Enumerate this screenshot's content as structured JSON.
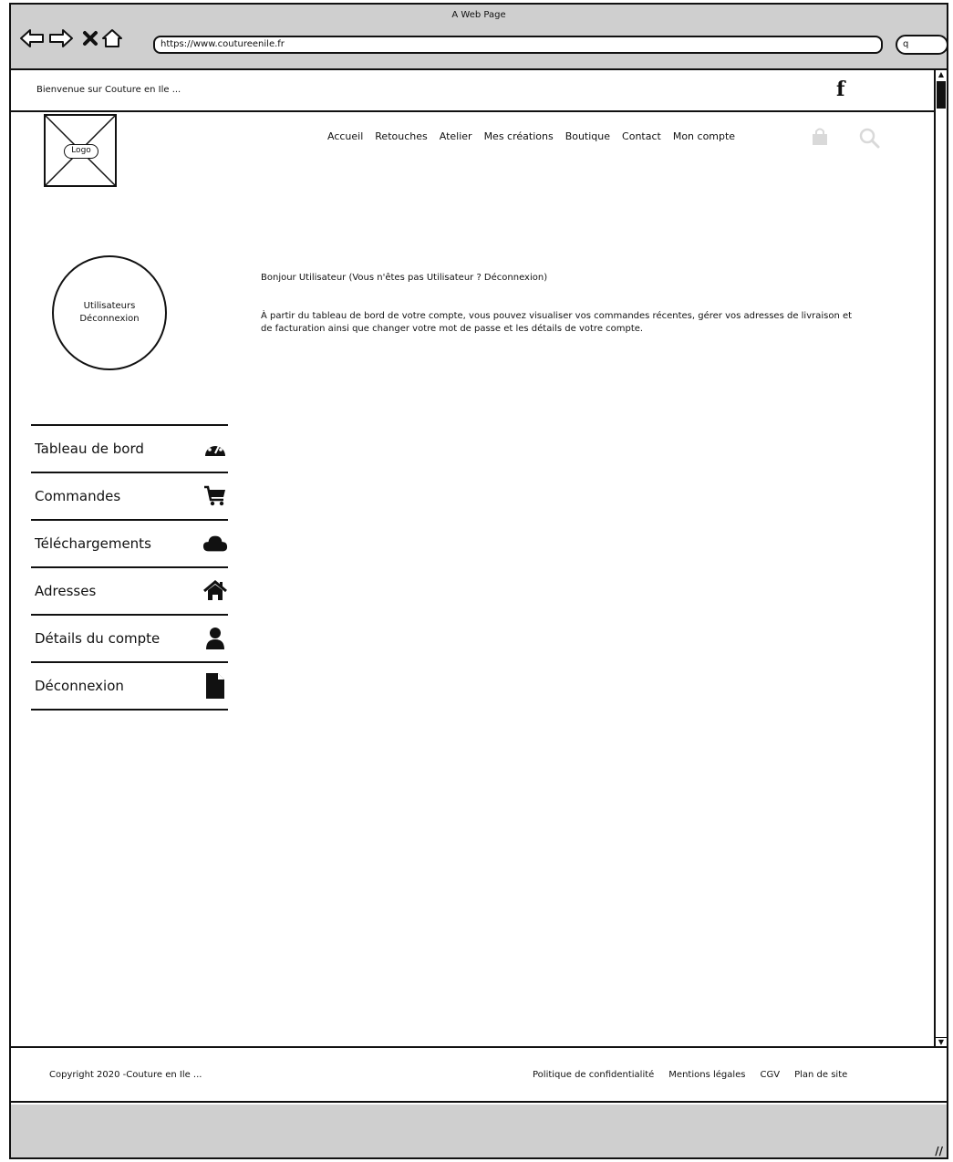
{
  "browser": {
    "window_title": "A Web Page",
    "url": "https://www.coutureenile.fr",
    "search_placeholder": "q"
  },
  "topbar": {
    "welcome": "Bienvenue sur Couture en Ile ...",
    "social": "f"
  },
  "header": {
    "logo_label": "Logo",
    "nav": [
      "Accueil",
      "Retouches",
      "Atelier",
      "Mes créations",
      "Boutique",
      "Contact",
      "Mon compte"
    ]
  },
  "avatar": {
    "line1": "Utilisateurs",
    "line2": "Déconnexion"
  },
  "main": {
    "hello": "Bonjour Utilisateur (Vous n'êtes pas Utilisateur ? Déconnexion)",
    "intro": "À partir du tableau de bord de votre compte, vous pouvez visualiser vos commandes récentes, gérer vos adresses de livraison et de facturation ainsi que changer votre mot de passe et les détails de votre compte."
  },
  "account_menu": [
    {
      "label": "Tableau de bord",
      "icon": "dashboard-icon"
    },
    {
      "label": "Commandes",
      "icon": "cart-icon"
    },
    {
      "label": "Téléchargements",
      "icon": "cloud-icon"
    },
    {
      "label": "Adresses",
      "icon": "home-icon"
    },
    {
      "label": "Détails du compte",
      "icon": "user-icon"
    },
    {
      "label": "Déconnexion",
      "icon": "document-icon"
    }
  ],
  "footer": {
    "copyright": "Copyright 2020 -Couture en Ile ...",
    "links": [
      "Politique de confidentialité",
      "Mentions légales",
      "CGV",
      "Plan de site"
    ]
  },
  "colors": {
    "chrome_bg": "#cfcfcf",
    "ink": "#111111",
    "muted_icon": "#d9d9d9"
  }
}
